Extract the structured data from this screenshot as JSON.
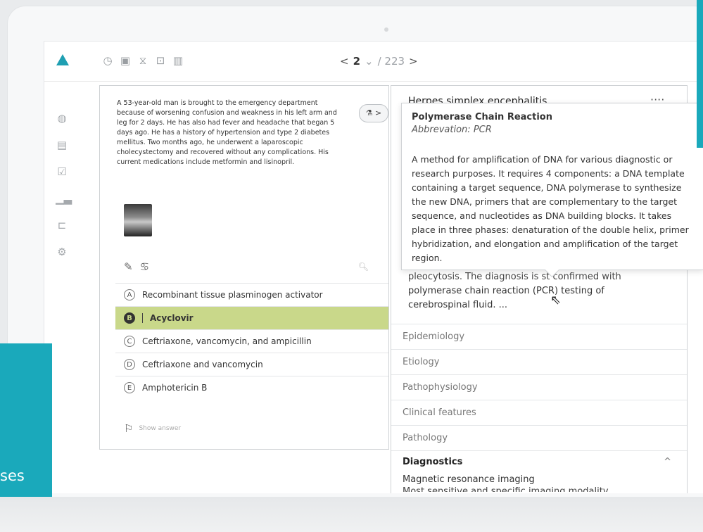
{
  "topbar": {
    "tool_icons": [
      "clock-icon",
      "inbox-icon",
      "hourglass-icon",
      "expand-icon",
      "bar-chart-icon"
    ],
    "pager": {
      "prev": "<",
      "current": "2",
      "dropdown": "⌄",
      "total": "/ 223",
      "next": ">"
    }
  },
  "sidebar": {
    "icons": [
      "globe-icon",
      "document-icon",
      "clipboard-icon",
      "stats-icon",
      "cart-icon",
      "settings-icon"
    ]
  },
  "question": {
    "stem": "A 53-year-old man is brought to the emergency department because of worsening confusion and weakness in his left arm and leg for 2 days. He has also had fever and headache that began 5 days ago. He has a history of hypertension and type 2 diabetes mellitus. Two months ago, he underwent a laparoscopic cholecystectomy and recovered without any complications. His current medications include metformin and lisinopril.",
    "lab_button": "⚗ >",
    "answers": [
      {
        "letter": "A",
        "text": "Recombinant tissue plasminogen activator"
      },
      {
        "letter": "B",
        "text": "Acyclovir"
      },
      {
        "letter": "C",
        "text": "Ceftriaxone, vancomycin, and ampicillin"
      },
      {
        "letter": "D",
        "text": "Ceftriaxone and vancomycin"
      },
      {
        "letter": "E",
        "text": "Amphotericin B"
      }
    ],
    "show_answer": "Show answer"
  },
  "article": {
    "title": "Herpes simplex encephalitis",
    "more": "····",
    "snippet_cut": "pleocytosis. The diagnosis is    st confirmed with",
    "snippet": "polymerase chain reaction (PCR) testing of cerebrospinal fluid. ...",
    "sections": [
      "Epidemiology",
      "Etiology",
      "Pathophysiology",
      "Clinical features",
      "Pathology"
    ],
    "diagnostics": {
      "heading": "Diagnostics",
      "chevron": "^",
      "line": "Magnetic resonance imaging",
      "cut": "Most sensitive and specific imaging modality"
    }
  },
  "tooltip": {
    "title": "Polymerase Chain Reaction",
    "abbreviation": "Abbrevation: PCR",
    "body": "A method for amplification of DNA for various diagnostic or research purposes. It requires 4 components: a DNA template containing a target sequence, DNA polymerase to synthesize the new DNA, primers that are complementary to the target sequence, and nucleotides as DNA building blocks. It takes place in three phases: denaturation of the double helix, primer hybridization, and elongation and amplification of the target region."
  },
  "overlay": {
    "teal_text": "ses"
  },
  "colors": {
    "accent": "#1aa9bb",
    "selected_answer": "#c9d88a"
  }
}
